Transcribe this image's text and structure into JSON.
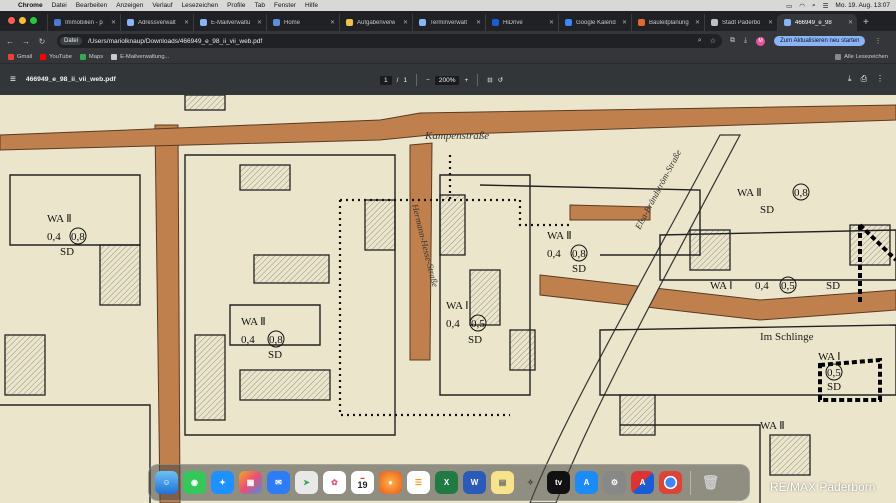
{
  "menubar": {
    "app_name": "Chrome",
    "items": [
      "Datei",
      "Bearbeiten",
      "Anzeigen",
      "Verlauf",
      "Lesezeichen",
      "Profile",
      "Tab",
      "Fenster",
      "Hilfe"
    ],
    "clock": "Mo. 19. Aug.  13:07"
  },
  "tabs": [
    {
      "label": "Immobilien - p",
      "color": "#4a7bd0"
    },
    {
      "label": "Adressverwalt",
      "color": "#8ab4f8"
    },
    {
      "label": "E-Mailverwaltu",
      "color": "#8ab4f8"
    },
    {
      "label": "Home",
      "color": "#5f8fd8"
    },
    {
      "label": "Aufgabenverw",
      "color": "#f0c24a"
    },
    {
      "label": "Terminverwalt",
      "color": "#8ab4f8"
    },
    {
      "label": "HiDrive",
      "color": "#1a5bd6"
    },
    {
      "label": "Google Kalend",
      "color": "#4285f4"
    },
    {
      "label": "Bauleitplanung",
      "color": "#e06a2c"
    },
    {
      "label": "Stadt Paderbo",
      "color": "#c0c0c0"
    },
    {
      "label": "466949_e_98",
      "color": "#8ab4f8",
      "active": true
    }
  ],
  "toolbar": {
    "chip": "Datei",
    "url": "/Users/mariolknaup/Downloads/466949_e_98_ii_vii_web.pdf",
    "update_button": "Zum Aktualisieren neu starten",
    "avatar": "M"
  },
  "bookmarks": {
    "items": [
      {
        "label": "Gmail",
        "color": "#ea4335"
      },
      {
        "label": "YouTube",
        "color": "#ff0000"
      },
      {
        "label": "Maps",
        "color": "#34a853"
      },
      {
        "label": "E-Mailverwaltung...",
        "color": "#c9c9c9"
      }
    ],
    "all_bookmarks": "Alle Lesezeichen"
  },
  "pdf": {
    "filename": "466949_e_98_ii_vii_web.pdf",
    "page_current": "1",
    "page_sep": "/",
    "page_total": "1",
    "zoom": "200%"
  },
  "map": {
    "streets": [
      "Kampenstraße",
      "Hermann-Hesse-Straße",
      "Elsa-Brändström-Straße",
      "Im Schlinge"
    ],
    "zones": [
      {
        "lines": [
          "WA Ⅱ",
          "0,4",
          "0,8",
          "SD"
        ]
      },
      {
        "lines": [
          "WA Ⅱ",
          "0,4",
          "0,8",
          "SD"
        ]
      },
      {
        "lines": [
          "WA Ⅱ",
          "0,4",
          "0,8",
          "SD"
        ]
      },
      {
        "lines": [
          "WA Ⅰ",
          "0,4",
          "0,5",
          "SD"
        ]
      },
      {
        "lines": [
          "WA Ⅱ",
          "0,4",
          "0,8",
          "SD"
        ]
      },
      {
        "lines": [
          "WA Ⅰ",
          "0,4",
          "0,5",
          "SD"
        ]
      }
    ],
    "zone_row": [
      "WA Ⅰ",
      "0,4",
      "0,5",
      "SD"
    ],
    "zone_bottom": "WA Ⅱ",
    "zone_right": [
      "WA Ⅰ",
      "0,5",
      "SD"
    ]
  },
  "dock": {
    "calendar_day": "19"
  },
  "watermark": "RE/MAX Paderborn"
}
